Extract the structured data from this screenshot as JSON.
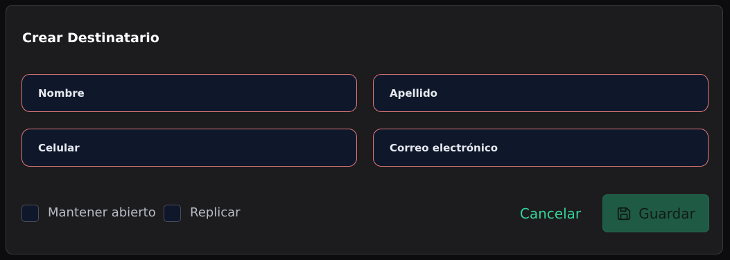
{
  "dialog": {
    "title": "Crear Destinatario"
  },
  "fields": {
    "nombre": {
      "placeholder": "Nombre",
      "value": ""
    },
    "apellido": {
      "placeholder": "Apellido",
      "value": ""
    },
    "celular": {
      "placeholder": "Celular",
      "value": ""
    },
    "correo": {
      "placeholder": "Correo electrónico",
      "value": ""
    }
  },
  "options": {
    "keep_open": {
      "label": "Mantener abierto",
      "checked": false
    },
    "replicate": {
      "label": "Replicar",
      "checked": false
    }
  },
  "actions": {
    "cancel_label": "Cancelar",
    "save_label": "Guardar",
    "save_icon": "floppy-disk-icon"
  },
  "colors": {
    "dialog_bg": "#1c1b1d",
    "field_bg": "#0f172a",
    "field_border": "#e07a7a",
    "accent": "#34d399",
    "save_bg": "#1f5a45"
  }
}
